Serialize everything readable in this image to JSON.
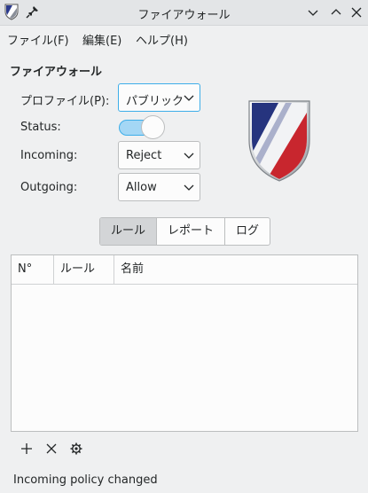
{
  "window": {
    "title": "ファイアウォール"
  },
  "menu": {
    "file": "ファイル(F)",
    "edit": "編集(E)",
    "help": "ヘルプ(H)"
  },
  "section": {
    "title": "ファイアウォール"
  },
  "form": {
    "profile_label": "プロファイル(P):",
    "profile_value": "パブリック",
    "status_label": "Status:",
    "status_on": true,
    "incoming_label": "Incoming:",
    "incoming_value": "Reject",
    "outgoing_label": "Outgoing:",
    "outgoing_value": "Allow"
  },
  "tabs": [
    {
      "label": "ルール",
      "active": true
    },
    {
      "label": "レポート",
      "active": false
    },
    {
      "label": "ログ",
      "active": false
    }
  ],
  "table": {
    "columns": [
      "N°",
      "ルール",
      "名前"
    ],
    "rows": []
  },
  "toolbar": {
    "icons": [
      "add-icon",
      "remove-icon",
      "settings-icon"
    ]
  },
  "status_bar": {
    "text": "Incoming policy changed"
  },
  "colors": {
    "accent": "#3daee9",
    "window_bg": "#eff0f1"
  }
}
